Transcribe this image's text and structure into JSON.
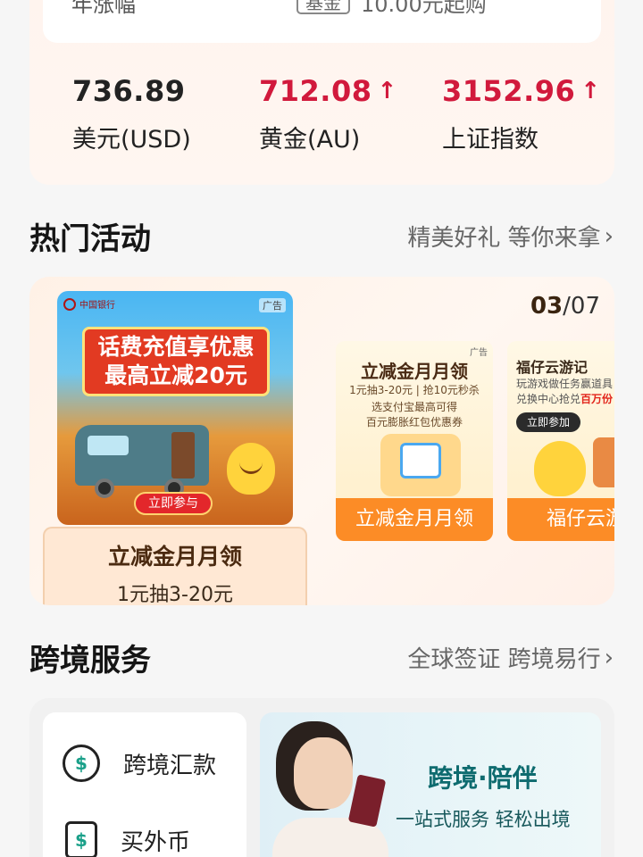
{
  "fund": {
    "label": "年涨幅",
    "tag": "基金",
    "min_buy": "10.00元起购"
  },
  "quotes": [
    {
      "value": "736.89",
      "name": "美元(USD)",
      "trend": "none"
    },
    {
      "value": "712.08",
      "name": "黄金(AU)",
      "trend": "up",
      "arrow": "↑"
    },
    {
      "value": "3152.96",
      "name": "上证指数",
      "trend": "up",
      "arrow": "↑"
    }
  ],
  "hot": {
    "title": "热门活动",
    "more": "精美好礼 等你来拿",
    "pager_current": "03",
    "pager_total": "/07",
    "main_ad": {
      "ad_tag": "广告",
      "bank_logo": "中国银行",
      "headline_1": "话费充值享优惠",
      "headline_2": "最高立减20元",
      "join": "立即参与",
      "caption_title": "立减金月月领",
      "caption_sub": "1元抽3-20元"
    },
    "card1": {
      "ad_tag": "广告",
      "title": "立减金月月领",
      "sub1": "1元抽3-20元 | 抢10元秒杀",
      "sub2": "选支付宝最高可得",
      "sub3": "百元膨胀红包优惠券",
      "bar": "立减金月月领"
    },
    "card2": {
      "title": "福仔云游记",
      "sub1": "玩游戏做任务赢道具",
      "sub2_prefix": "兑换中心抢兑",
      "sub2_red": "百万份",
      "button": "立即参加",
      "bar": "福仔云游"
    }
  },
  "cross": {
    "title": "跨境服务",
    "more": "全球签证 跨境易行",
    "items": [
      {
        "label": "跨境汇款",
        "icon": "exchange-dollar-icon"
      },
      {
        "label": "买外币",
        "icon": "foreign-currency-doc-icon"
      }
    ],
    "banner_title": "跨境·陪伴",
    "banner_sub": "一站式服务 轻松出境"
  },
  "colors": {
    "up": "#d1193c",
    "accent_orange": "#fc8c26",
    "teal": "#0e6b6f"
  }
}
